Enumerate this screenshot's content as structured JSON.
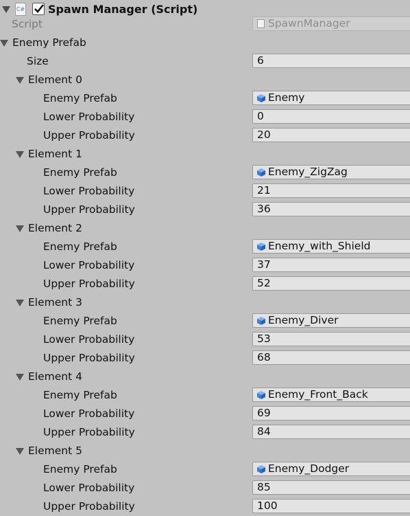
{
  "component": {
    "title": "Spawn Manager (Script)",
    "enabled": true,
    "script_label": "Script",
    "script_value": "SpawnManager"
  },
  "array": {
    "label": "Enemy Prefab",
    "size_label": "Size",
    "size_value": "6",
    "elements": [
      {
        "label": "Element 0",
        "prefab_label": "Enemy Prefab",
        "prefab": "Enemy",
        "lower_label": "Lower Probability",
        "lower": "0",
        "upper_label": "Upper Probability",
        "upper": "20"
      },
      {
        "label": "Element 1",
        "prefab_label": "Enemy Prefab",
        "prefab": "Enemy_ZigZag",
        "lower_label": "Lower Probability",
        "lower": "21",
        "upper_label": "Upper Probability",
        "upper": "36"
      },
      {
        "label": "Element 2",
        "prefab_label": "Enemy Prefab",
        "prefab": "Enemy_with_Shield",
        "lower_label": "Lower Probability",
        "lower": "37",
        "upper_label": "Upper Probability",
        "upper": "52"
      },
      {
        "label": "Element 3",
        "prefab_label": "Enemy Prefab",
        "prefab": "Enemy_Diver",
        "lower_label": "Lower Probability",
        "lower": "53",
        "upper_label": "Upper Probability",
        "upper": "68"
      },
      {
        "label": "Element 4",
        "prefab_label": "Enemy Prefab",
        "prefab": "Enemy_Front_Back",
        "lower_label": "Lower Probability",
        "lower": "69",
        "upper_label": "Upper Probability",
        "upper": "84"
      },
      {
        "label": "Element 5",
        "prefab_label": "Enemy Prefab",
        "prefab": "Enemy_Dodger",
        "lower_label": "Lower Probability",
        "lower": "85",
        "upper_label": "Upper Probability",
        "upper": "100"
      }
    ]
  },
  "icons": {
    "component": "csharp-script-icon",
    "prefab": "prefab-cube-icon",
    "fold": "foldout-triangle-icon"
  },
  "colors": {
    "background": "#c2c2c2",
    "field": "#e3e3e3",
    "cube_blue": "#3d7fd8"
  }
}
